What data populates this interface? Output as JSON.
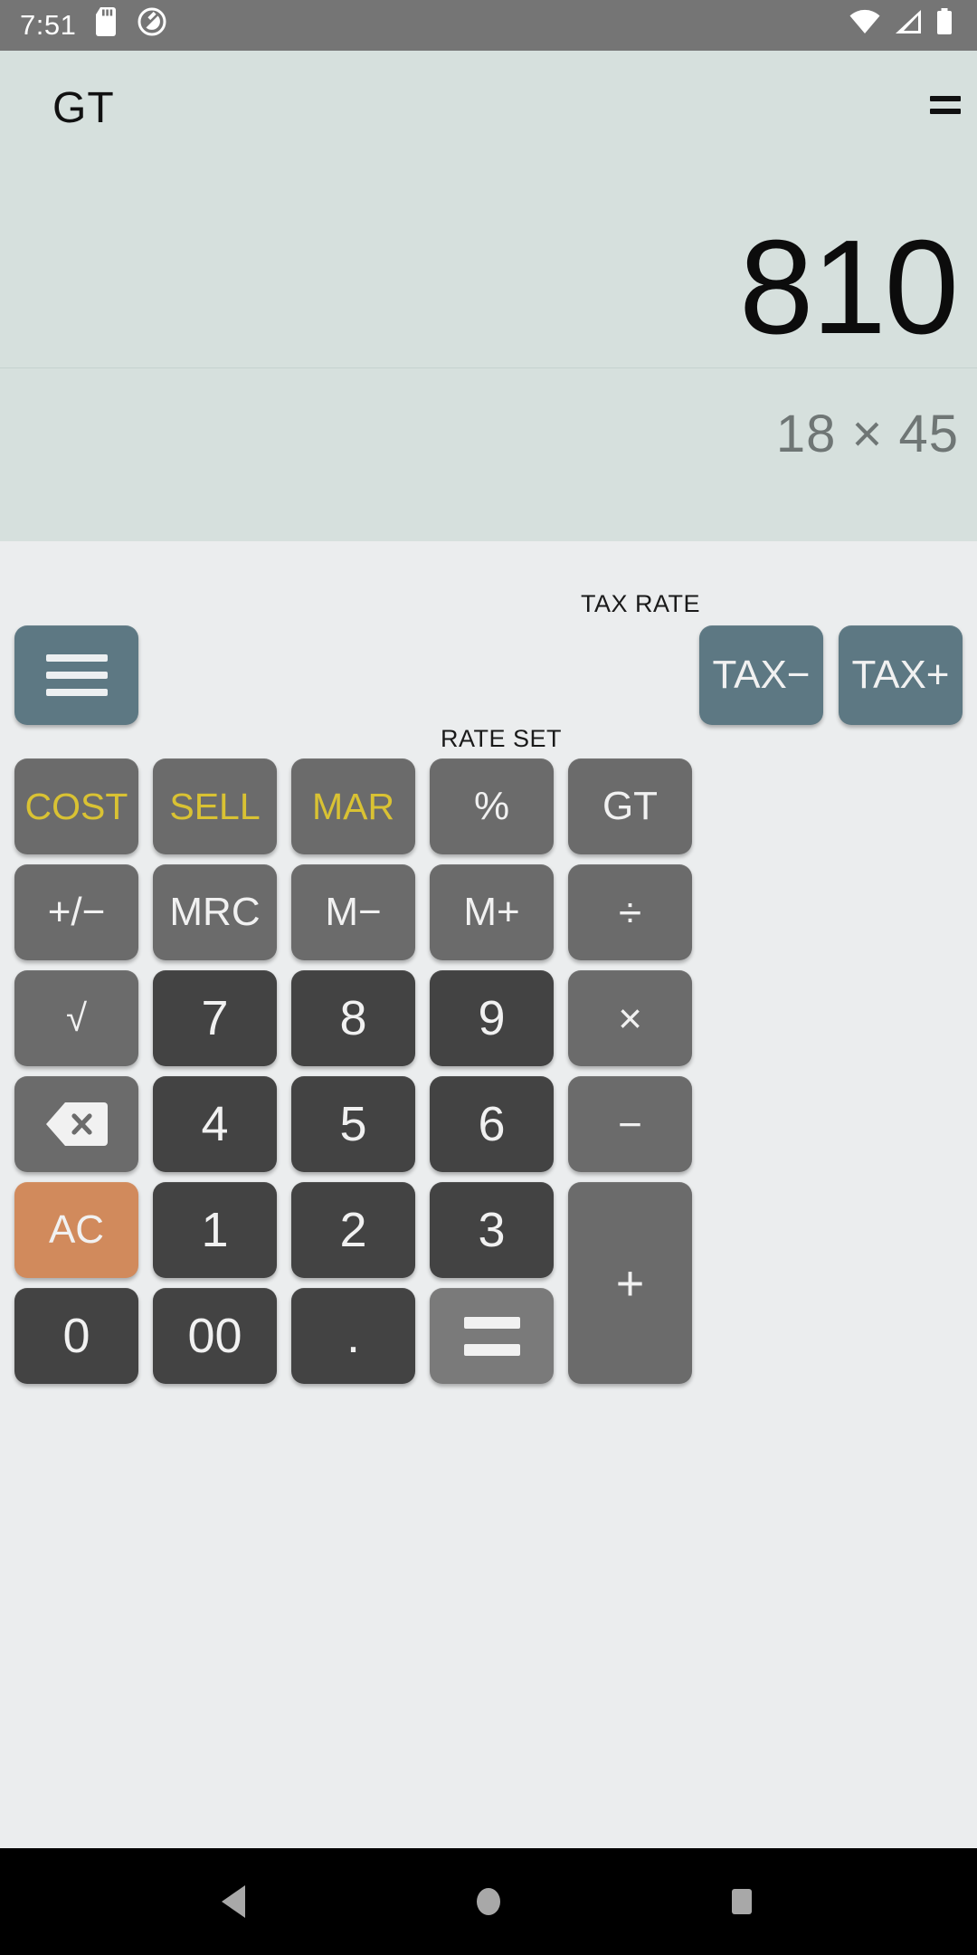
{
  "status_bar": {
    "time": "7:51",
    "icons_left": [
      "sd-card-icon",
      "do-not-disturb-icon"
    ],
    "icons_right": [
      "wifi-icon",
      "cellular-signal-icon",
      "battery-icon"
    ],
    "background": "#757575"
  },
  "display": {
    "gt_indicator": "GT",
    "equals_indicator": "=",
    "value": "810",
    "expression": "18 × 45",
    "background": "#d6e0dd",
    "value_color": "#0c0c0c",
    "expression_color": "#6f7675"
  },
  "keypad": {
    "background": "#ebedee",
    "labels": {
      "tax_rate": "TAX RATE",
      "rate_set": "RATE SET"
    },
    "keys": {
      "menu": "menu-icon",
      "tax_minus": "TAX−",
      "tax_plus": "TAX+",
      "cost": "COST",
      "sell": "SELL",
      "mar": "MAR",
      "percent": "%",
      "gt": "GT",
      "sign": "+/−",
      "mrc": "MRC",
      "m_minus": "M−",
      "m_plus": "M+",
      "divide": "÷",
      "sqrt": "√",
      "seven": "7",
      "eight": "8",
      "nine": "9",
      "multiply": "×",
      "backspace": "backspace-icon",
      "four": "4",
      "five": "5",
      "six": "6",
      "minus": "−",
      "ac": "AC",
      "one": "1",
      "two": "2",
      "three": "3",
      "plus": "+",
      "zero": "0",
      "double_zero": "00",
      "decimal": ".",
      "equals": "="
    },
    "colors": {
      "number_key": "#434343",
      "function_key": "#6b6b6b",
      "tax_key": "#5d7883",
      "clear_key": "#d18a5c",
      "gold_text": "#d9c233",
      "equals_key": "#7a7a7a"
    }
  },
  "nav_bar": {
    "background": "#000000",
    "buttons": [
      "back-icon",
      "home-icon",
      "recents-icon"
    ]
  }
}
